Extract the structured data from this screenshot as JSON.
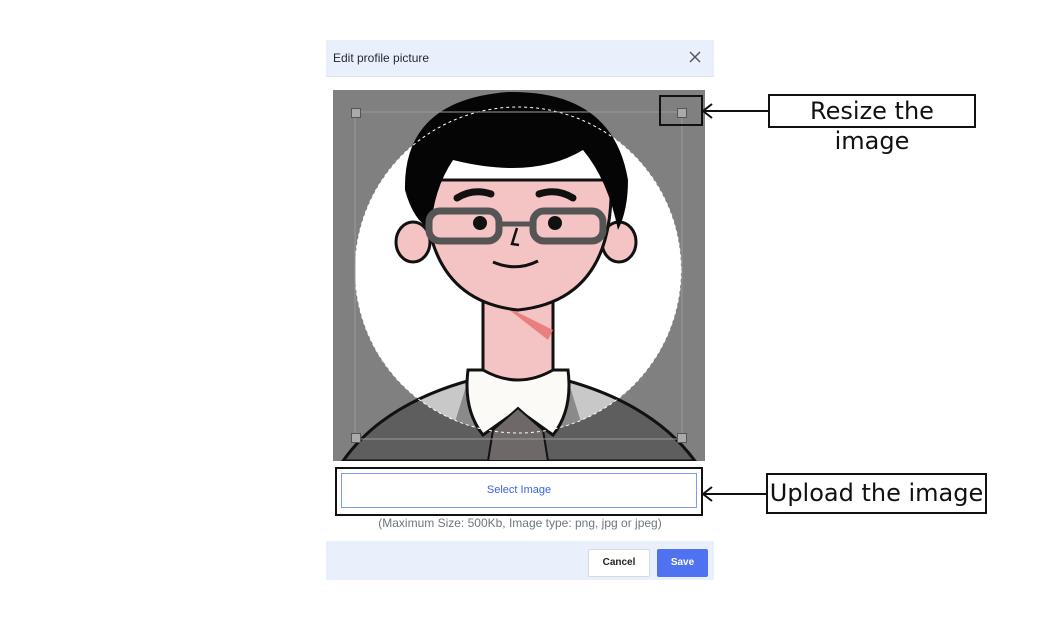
{
  "dialog": {
    "title": "Edit profile picture",
    "close_icon": "close-icon"
  },
  "cropper": {
    "handle_icon": "resize-handle-icon",
    "avatar_description_icon": "avatar-image"
  },
  "upload": {
    "select_label": "Select Image",
    "hint": "(Maximum Size: 500Kb, Image type: png, jpg or jpeg)"
  },
  "footer": {
    "cancel_label": "Cancel",
    "save_label": "Save"
  },
  "annotations": {
    "resize": "Resize the image",
    "upload": "Upload the image"
  },
  "colors": {
    "accent": "#4f73f0",
    "header_bg": "#eaf0fb",
    "crop_bg": "#808080"
  }
}
